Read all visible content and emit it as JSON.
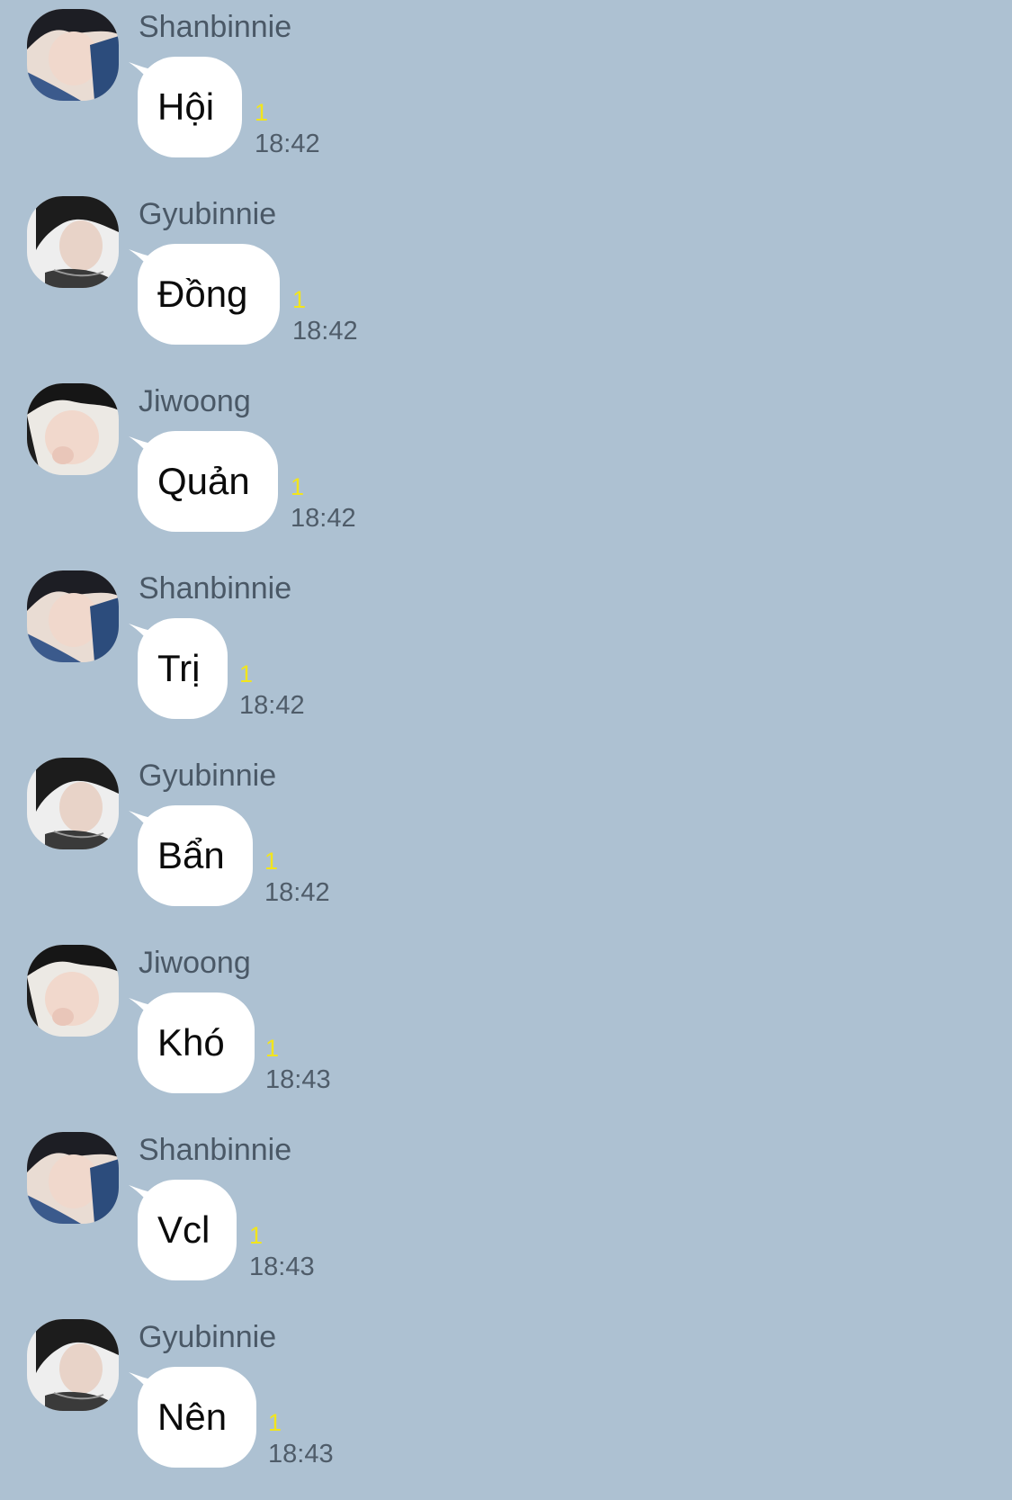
{
  "background_color": "#adc1d2",
  "messages": [
    {
      "sender": "Shanbinnie",
      "text": "Hội",
      "unread": "1",
      "time": "18:42",
      "avatar": "shanbinnie-avatar"
    },
    {
      "sender": "Gyubinnie",
      "text": "Đồng",
      "unread": "1",
      "time": "18:42",
      "avatar": "gyubinnie-avatar"
    },
    {
      "sender": "Jiwoong",
      "text": "Quản",
      "unread": "1",
      "time": "18:42",
      "avatar": "jiwoong-avatar"
    },
    {
      "sender": "Shanbinnie",
      "text": "Trị",
      "unread": "1",
      "time": "18:42",
      "avatar": "shanbinnie-avatar"
    },
    {
      "sender": "Gyubinnie",
      "text": "Bẩn",
      "unread": "1",
      "time": "18:42",
      "avatar": "gyubinnie-avatar"
    },
    {
      "sender": "Jiwoong",
      "text": "Khó",
      "unread": "1",
      "time": "18:43",
      "avatar": "jiwoong-avatar"
    },
    {
      "sender": "Shanbinnie",
      "text": "Vcl",
      "unread": "1",
      "time": "18:43",
      "avatar": "shanbinnie-avatar"
    },
    {
      "sender": "Gyubinnie",
      "text": "Nên",
      "unread": "1",
      "time": "18:43",
      "avatar": "gyubinnie-avatar"
    }
  ]
}
